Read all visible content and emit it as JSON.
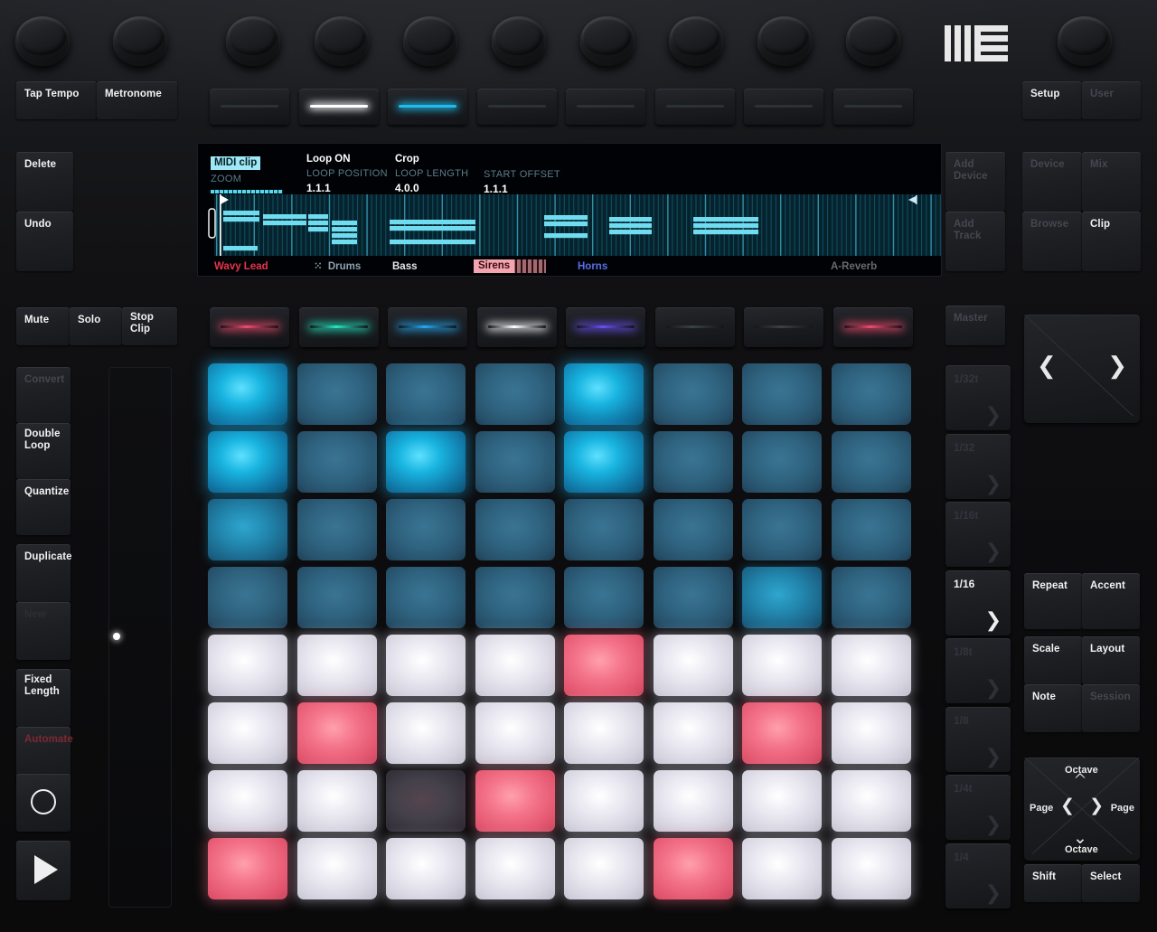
{
  "device": {
    "brand_logo": "ableton-logo"
  },
  "top_left_buttons": [
    {
      "label": "Tap Tempo",
      "state": "on"
    },
    {
      "label": "Metronome",
      "state": "on"
    }
  ],
  "top_row_rgb_buttons": [
    {
      "index": 1,
      "led": "#2a3238"
    },
    {
      "index": 2,
      "led": "#ffffff"
    },
    {
      "index": 3,
      "led": "#1fbced"
    },
    {
      "index": 4,
      "led": "#2a3238"
    },
    {
      "index": 5,
      "led": "#2a3238"
    },
    {
      "index": 6,
      "led": "#2a3238"
    },
    {
      "index": 7,
      "led": "#2a3238"
    },
    {
      "index": 8,
      "led": "#2a3238"
    }
  ],
  "top_right_buttons": [
    {
      "label": "Setup",
      "state": "on"
    },
    {
      "label": "User",
      "state": "dim"
    }
  ],
  "left_column": [
    {
      "label": "Delete",
      "state": "on"
    },
    {
      "label": "Undo",
      "state": "on"
    }
  ],
  "mute_solo_row": [
    {
      "label": "Mute",
      "state": "on"
    },
    {
      "label": "Solo",
      "state": "on"
    },
    {
      "label": "Stop Clip",
      "line1": "Stop",
      "line2": "Clip",
      "state": "on"
    }
  ],
  "clip_column": [
    {
      "label": "Convert",
      "state": "dim"
    },
    {
      "label": "Double Loop",
      "line1": "Double",
      "line2": "Loop",
      "state": "on"
    },
    {
      "label": "Quantize",
      "state": "on"
    },
    {
      "label": "Duplicate",
      "state": "on"
    },
    {
      "label": "New",
      "state": "dimmer"
    },
    {
      "label": "Fixed Length",
      "line1": "Fixed",
      "line2": "Length",
      "state": "on"
    },
    {
      "label": "Automate",
      "state": "red"
    },
    {
      "label": "Record",
      "icon": "record-circle-icon",
      "state": "on"
    },
    {
      "label": "Play",
      "icon": "play-triangle-icon",
      "state": "on"
    }
  ],
  "right_column_top": [
    {
      "label": "Add Device",
      "line1": "Add",
      "line2": "Device",
      "state": "dim"
    },
    {
      "label": "Add Track",
      "line1": "Add",
      "line2": "Track",
      "state": "dim"
    }
  ],
  "mode_buttons": [
    {
      "label": "Device",
      "state": "dim"
    },
    {
      "label": "Mix",
      "state": "dim"
    },
    {
      "label": "Browse",
      "state": "dim"
    },
    {
      "label": "Clip",
      "state": "on"
    }
  ],
  "master_button": {
    "label": "Master",
    "state": "dim"
  },
  "quantize_buttons": [
    {
      "label": "1/32t",
      "state": "off"
    },
    {
      "label": "1/32",
      "state": "off"
    },
    {
      "label": "1/16t",
      "state": "off"
    },
    {
      "label": "1/16",
      "state": "on"
    },
    {
      "label": "1/8t",
      "state": "off"
    },
    {
      "label": "1/8",
      "state": "off"
    },
    {
      "label": "1/4t",
      "state": "off"
    },
    {
      "label": "1/4",
      "state": "off"
    }
  ],
  "nav_dpad": {
    "left_icon": "chevron-left-icon",
    "right_icon": "chevron-right-icon"
  },
  "repeat_accent": [
    {
      "label": "Repeat",
      "state": "on"
    },
    {
      "label": "Accent",
      "state": "on"
    }
  ],
  "scale_layout": [
    {
      "label": "Scale",
      "state": "on"
    },
    {
      "label": "Layout",
      "state": "on"
    },
    {
      "label": "Note",
      "state": "on"
    },
    {
      "label": "Session",
      "state": "dim"
    }
  ],
  "octave_dpad": {
    "up_label": "Octave",
    "down_label": "Octave",
    "left_label": "Page",
    "right_label": "Page",
    "up_icon": "chevron-up-icon",
    "down_icon": "chevron-down-icon",
    "left_icon": "chevron-left-icon",
    "right_icon": "chevron-right-icon"
  },
  "shift_select": [
    {
      "label": "Shift",
      "state": "on"
    },
    {
      "label": "Select",
      "state": "on"
    }
  ],
  "display": {
    "clip_type": "MIDI clip",
    "columns": [
      {
        "title": "",
        "label": "ZOOM",
        "value": "",
        "has_bar": true
      },
      {
        "title": "Loop ON",
        "label": "LOOP POSITION",
        "value": "1.1.1",
        "has_bar": false
      },
      {
        "title": "Crop",
        "label": "LOOP LENGTH",
        "value": "4.0.0",
        "has_bar": false
      },
      {
        "title": "",
        "label": "START OFFSET",
        "value": "1.1.1",
        "has_bar": false
      }
    ],
    "track_names": [
      {
        "name": "Wavy Lead",
        "color": "#e8354b",
        "style": "plain"
      },
      {
        "name": "Drums",
        "color": "#8fa1ad",
        "style": "dots"
      },
      {
        "name": "Bass",
        "color": "#dfe6ea",
        "style": "plain"
      },
      {
        "name": "Sirens",
        "color": "#3a0d12",
        "style": "highlight",
        "highlight": "#f4a4ae"
      },
      {
        "name": "Horns",
        "color": "#5b6fe8",
        "style": "plain"
      },
      {
        "name": "A-Reverb",
        "color": "#6a6a6a",
        "style": "plain"
      }
    ],
    "note_color": "#6fdcef",
    "grid_color": "#0f5a6e"
  },
  "track_select_buttons": [
    {
      "index": 1,
      "led": "#f04a6e"
    },
    {
      "index": 2,
      "led": "#24e6c0"
    },
    {
      "index": 3,
      "led": "#24a8f0"
    },
    {
      "index": 4,
      "led": "#ffffff"
    },
    {
      "index": 5,
      "led": "#6a4ef0"
    },
    {
      "index": 6,
      "led": "#3a4148"
    },
    {
      "index": 7,
      "led": "#3a4148"
    },
    {
      "index": 8,
      "led": "#f04a6e"
    }
  ],
  "pad_grid": {
    "rows": 8,
    "cols": 8,
    "colors": {
      "blue_bright": "#18b4e0",
      "blue_dim": "#2d5a72",
      "blue_mid": "#2686ad",
      "white": "#e2e2ea",
      "red": "#f4748a",
      "dark": "#3c3c46"
    },
    "cells": [
      [
        "blue_bright",
        "blue_dim",
        "blue_dim",
        "blue_dim",
        "blue_bright",
        "blue_dim",
        "blue_dim",
        "blue_dim"
      ],
      [
        "blue_bright",
        "blue_dim",
        "blue_bright",
        "blue_dim",
        "blue_bright",
        "blue_dim",
        "blue_dim",
        "blue_dim"
      ],
      [
        "blue_mid",
        "blue_dim",
        "blue_dim",
        "blue_dim",
        "blue_dim",
        "blue_dim",
        "blue_dim",
        "blue_dim"
      ],
      [
        "blue_dim",
        "blue_dim",
        "blue_dim",
        "blue_dim",
        "blue_dim",
        "blue_dim",
        "blue_mid",
        "blue_dim"
      ],
      [
        "white",
        "white",
        "white",
        "white",
        "red",
        "white",
        "white",
        "white"
      ],
      [
        "white",
        "red",
        "white",
        "white",
        "white",
        "white",
        "red",
        "white"
      ],
      [
        "white",
        "white",
        "dark",
        "red",
        "white",
        "white",
        "white",
        "white"
      ],
      [
        "red",
        "white",
        "white",
        "white",
        "white",
        "red",
        "white",
        "white"
      ]
    ]
  },
  "touch_strip": {
    "name": "touch-strip",
    "led_position_pct": 49
  }
}
